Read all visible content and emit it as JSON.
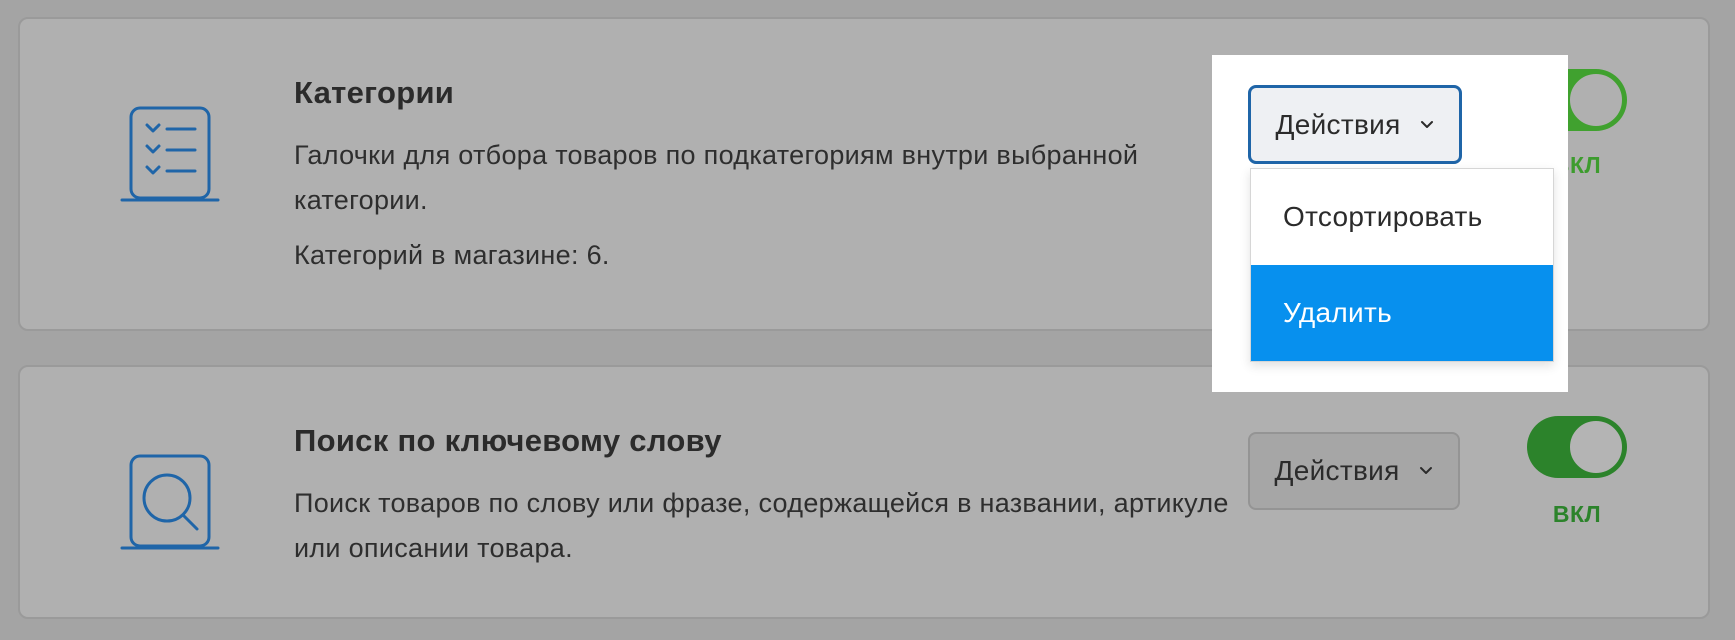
{
  "features": [
    {
      "icon": "checklist-icon",
      "title": "Категории",
      "description": "Галочки для отбора товаров по подкатегориям внутри выбранной категории.",
      "count_text": "Категорий в магазине: 6.",
      "actions_label": "Действия",
      "toggle_on": true,
      "toggle_label": "ВКЛ"
    },
    {
      "icon": "search-icon",
      "title": "Поиск по ключевому слову",
      "description": "Поиск товаров по слову или фразе, содержащейся в названии, артикуле или описании товара.",
      "actions_label": "Действия",
      "toggle_on": true,
      "toggle_label": "ВКЛ"
    }
  ],
  "dropdown": {
    "button_label": "Действия",
    "items": [
      {
        "label": "Отсортировать",
        "highlighted": false
      },
      {
        "label": "Удалить",
        "highlighted": true
      }
    ]
  },
  "colors": {
    "icon_blue": "#1f65a8",
    "toggle_green": "#2c832b",
    "menu_highlight": "#0790ee"
  }
}
